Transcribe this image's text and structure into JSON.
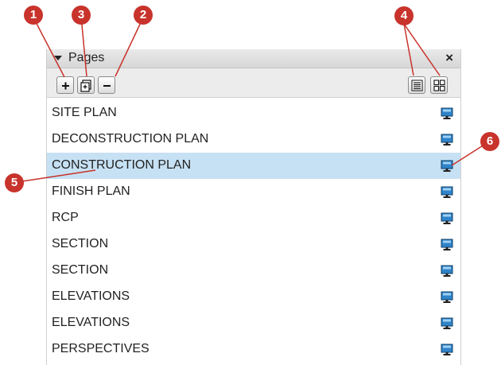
{
  "panel": {
    "title": "Pages",
    "close_label": "×"
  },
  "toolbar": {
    "buttons": [
      {
        "name": "add-page-button",
        "icon": "plus-icon"
      },
      {
        "name": "duplicate-page-button",
        "icon": "duplicate-icon"
      },
      {
        "name": "remove-page-button",
        "icon": "minus-icon"
      },
      {
        "name": "list-view-button",
        "icon": "list-icon"
      },
      {
        "name": "thumbnail-view-button",
        "icon": "grid-icon"
      }
    ]
  },
  "pages": [
    {
      "name": "SITE PLAN",
      "selected": false
    },
    {
      "name": "DECONSTRUCTION PLAN",
      "selected": false
    },
    {
      "name": "CONSTRUCTION PLAN",
      "selected": true
    },
    {
      "name": "FINISH PLAN",
      "selected": false
    },
    {
      "name": "RCP",
      "selected": false
    },
    {
      "name": "SECTION",
      "selected": false
    },
    {
      "name": "SECTION",
      "selected": false
    },
    {
      "name": "ELEVATIONS",
      "selected": false
    },
    {
      "name": "ELEVATIONS",
      "selected": false
    },
    {
      "name": "PERSPECTIVES",
      "selected": false
    }
  ],
  "callouts": [
    "1",
    "2",
    "3",
    "4",
    "5",
    "6"
  ],
  "colors": {
    "selection": "#c7e1f4",
    "callout": "#c8332b",
    "monitor": "#2f83c9"
  }
}
